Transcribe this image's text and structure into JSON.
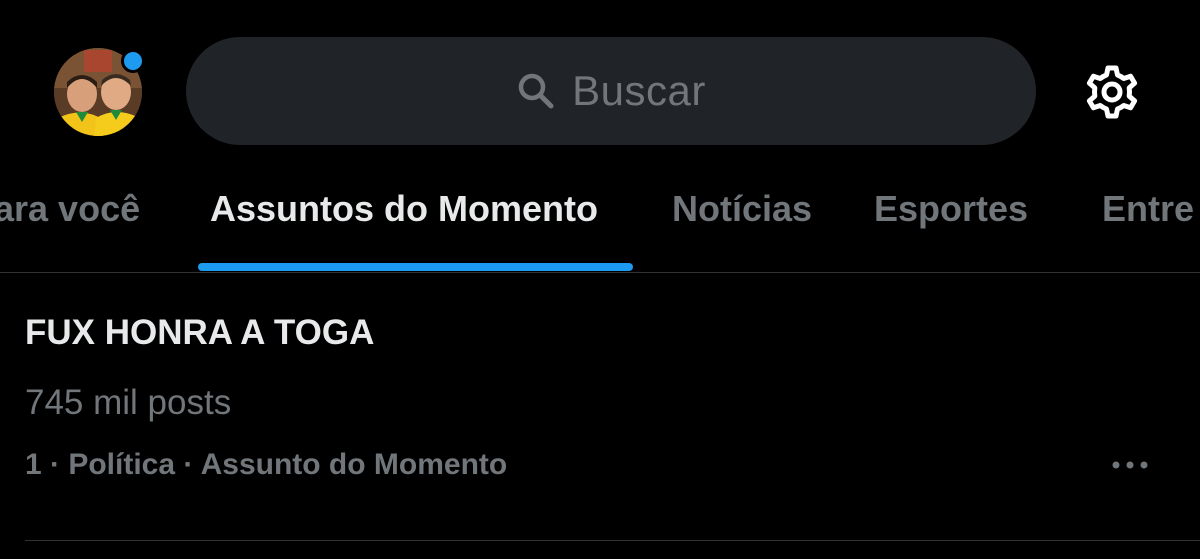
{
  "header": {
    "search_placeholder": "Buscar"
  },
  "tabs": [
    {
      "label": "ara você",
      "active": false
    },
    {
      "label": "Assuntos do Momento",
      "active": true
    },
    {
      "label": "Notícias",
      "active": false
    },
    {
      "label": "Esportes",
      "active": false
    },
    {
      "label": "Entre",
      "active": false
    }
  ],
  "trend": {
    "title": "FUX HONRA A TOGA",
    "count": "745 mil posts",
    "meta": "1 · Política · Assunto do Momento"
  },
  "colors": {
    "accent": "#1d9bf0",
    "background": "#000000",
    "muted": "#71767b",
    "text": "#e7e9ea"
  }
}
